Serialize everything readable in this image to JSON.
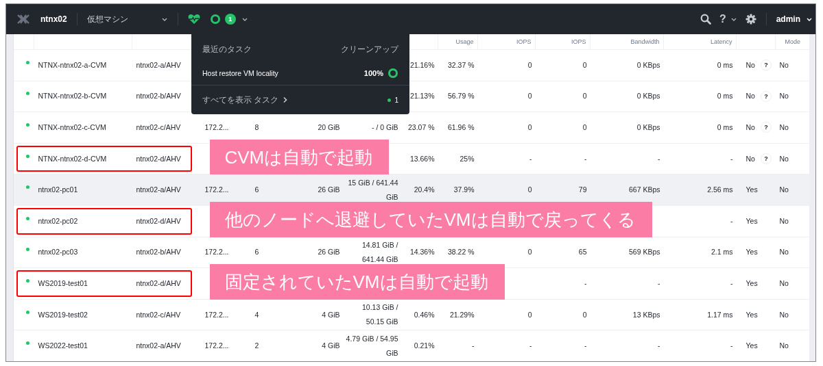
{
  "topbar": {
    "cluster": "ntnx02",
    "view": "仮想マシン",
    "alert_count": "1",
    "help": "?",
    "user": "admin"
  },
  "table": {
    "headers": {
      "memory_usage": "Usage",
      "read_iops": "IOPS",
      "write_iops": "IOPS",
      "bandwidth": "Bandwidth",
      "latency": "Latency",
      "mode": "Mode"
    },
    "rows": [
      {
        "name": "NTNX-ntnx02-a-CVM",
        "host": "ntnx02-a/AHV",
        "cells": [
          null,
          null,
          null,
          null,
          "21.16%",
          "32.37 %",
          "0",
          "0",
          "0 KBps",
          "0 ms"
        ],
        "ngt": "No",
        "ngt_help": "?",
        "mode": "No",
        "hovered": false,
        "boxed": false
      },
      {
        "name": "NTNX-ntnx02-b-CVM",
        "host": "ntnx02-b/AHV",
        "cells": [
          null,
          null,
          null,
          null,
          "21.13%",
          "56.79 %",
          "0",
          "0",
          "0 KBps",
          "0 ms"
        ],
        "ngt": "No",
        "ngt_help": "?",
        "mode": "No",
        "hovered": false,
        "boxed": false
      },
      {
        "name": "NTNX-ntnx02-c-CVM",
        "host": "ntnx02-c/AHV",
        "cells": [
          "172.2...",
          "8",
          "20 GiB",
          "- / 0 GiB",
          "23.07 %",
          "61.96 %",
          "0",
          "0",
          "0 KBps",
          "0 ms"
        ],
        "ngt": "No",
        "ngt_help": "?",
        "mode": "No",
        "hovered": false,
        "boxed": false
      },
      {
        "name": "NTNX-ntnx02-d-CVM",
        "host": "ntnx02-d/AHV",
        "cells": [
          null,
          null,
          null,
          null,
          "13.66%",
          "25%",
          "-",
          "-",
          "-",
          "-"
        ],
        "ngt": "No",
        "ngt_help": "?",
        "mode": "No",
        "hovered": false,
        "boxed": true,
        "callout": "CVMは自動で起動"
      },
      {
        "name": "ntnx02-pc01",
        "host": "ntnx02-a/AHV",
        "cells": [
          "172.2...",
          "6",
          "26 GiB",
          "15 GiB / 641.44 GiB",
          "20.4%",
          "37.9%",
          "0",
          "79",
          "667 KBps",
          "2.56 ms"
        ],
        "ngt": "Yes",
        "mode": "No",
        "hovered": true,
        "boxed": false
      },
      {
        "name": "ntnx02-pc02",
        "host": "ntnx02-d/AHV",
        "cells": [
          null,
          null,
          null,
          null,
          null,
          null,
          null,
          null,
          null,
          "-"
        ],
        "ngt": "Yes",
        "mode": "No",
        "hovered": false,
        "boxed": true,
        "callout": "他のノードへ退避していたVMは自動で戻ってくる"
      },
      {
        "name": "ntnx02-pc03",
        "host": "ntnx02-b/AHV",
        "cells": [
          "172.2...",
          "6",
          "26 GiB",
          "14.81 GiB / 641.44 GiB",
          "14.36%",
          "38.22 %",
          "0",
          "65",
          "569 KBps",
          "2.1 ms"
        ],
        "ngt": "Yes",
        "mode": "No",
        "hovered": false,
        "boxed": false
      },
      {
        "name": "WS2019-test01",
        "host": "ntnx02-d/AHV",
        "cells": [
          null,
          null,
          null,
          null,
          null,
          null,
          null,
          "-",
          "-",
          "-"
        ],
        "ngt": "Yes",
        "mode": "No",
        "hovered": false,
        "boxed": true,
        "callout": "固定されていたVMは自動で起動"
      },
      {
        "name": "WS2019-test02",
        "host": "ntnx02-c/AHV",
        "cells": [
          "172.2...",
          "4",
          "4 GiB",
          "10.13 GiB / 50.15 GiB",
          "0.46%",
          "21.29%",
          "0",
          "0",
          "13 KBps",
          "1.17 ms"
        ],
        "ngt": "Yes",
        "mode": "No",
        "hovered": false,
        "boxed": false
      },
      {
        "name": "WS2022-test01",
        "host": "ntnx02-a/AHV",
        "cells": [
          "172.2...",
          "2",
          "4 GiB",
          "4.79 GiB / 54.95 GiB",
          "0.21%",
          "-",
          "-",
          "-",
          "-",
          "-"
        ],
        "ngt": "Yes",
        "mode": "No",
        "hovered": false,
        "boxed": false
      }
    ]
  },
  "task_popup": {
    "title": "最近のタスク",
    "action": "クリーンアップ",
    "tasks": [
      {
        "name": "Host restore VM locality",
        "progress": "100%",
        "level": 1,
        "done": true
      }
    ],
    "footer_link": "すべてを表示 タスク",
    "footer_count": "1"
  }
}
